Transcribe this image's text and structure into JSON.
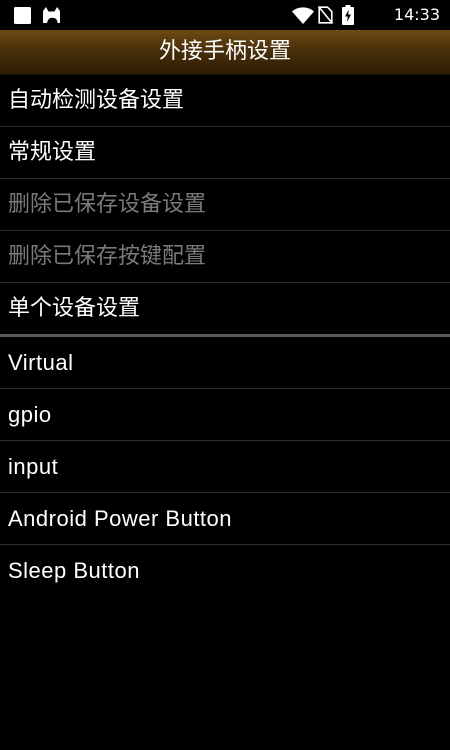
{
  "status_bar": {
    "time": "14:33",
    "icons": [
      "notification-square-icon",
      "cat-app-icon",
      "wifi-icon",
      "no-sim-icon",
      "battery-charging-icon"
    ]
  },
  "header": {
    "title": "外接手柄设置"
  },
  "menu": {
    "items": [
      {
        "label": "自动检测设备设置",
        "enabled": true
      },
      {
        "label": "常规设置",
        "enabled": true
      },
      {
        "label": "删除已保存设备设置",
        "enabled": false
      },
      {
        "label": "删除已保存按键配置",
        "enabled": false
      },
      {
        "label": "单个设备设置",
        "enabled": true
      }
    ],
    "devices": [
      {
        "label": "Virtual"
      },
      {
        "label": "gpio"
      },
      {
        "label": "input"
      },
      {
        "label": "Android Power Button"
      },
      {
        "label": "Sleep Button"
      }
    ]
  }
}
